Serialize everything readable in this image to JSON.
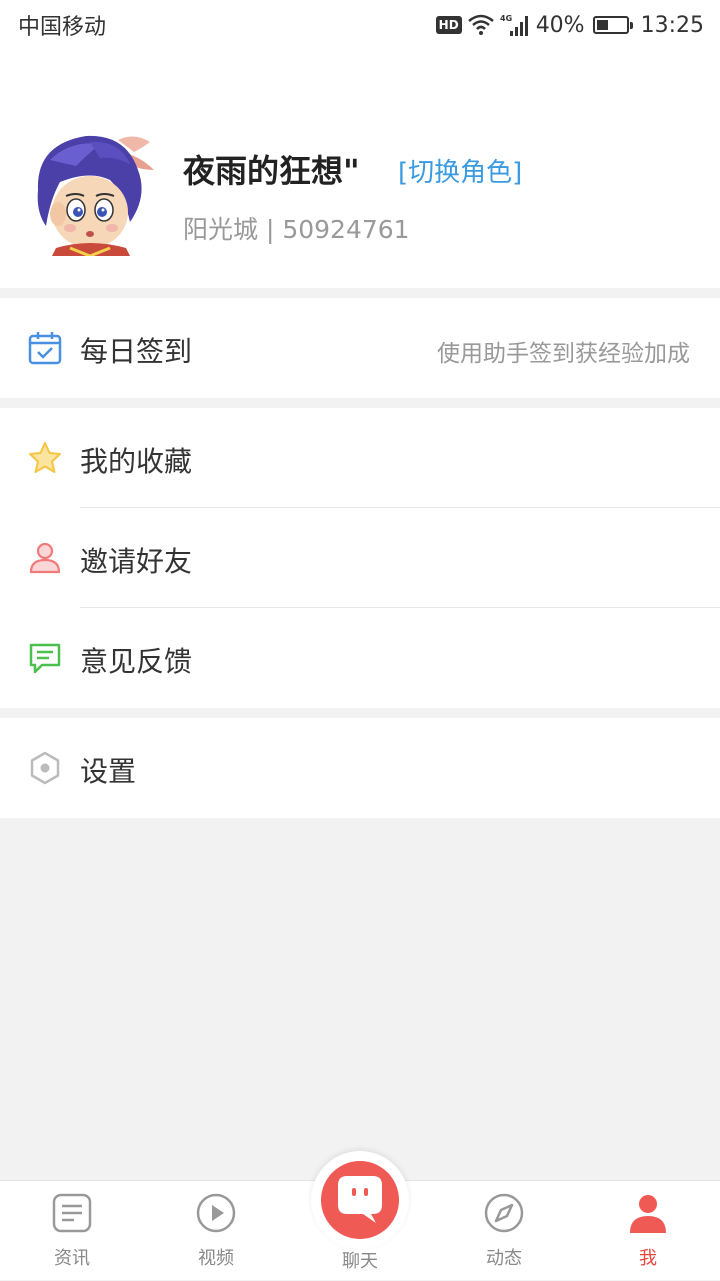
{
  "status_bar": {
    "carrier": "中国移动",
    "hd": "HD",
    "network": "4G",
    "battery": "40%",
    "battery_level": 0.4,
    "time": "13:25"
  },
  "profile": {
    "name": "夜雨的狂想\"",
    "switch_role": "[切换角色]",
    "server_and_id": "阳光城 | 50924761"
  },
  "menu": {
    "checkin": {
      "label": "每日签到",
      "hint": "使用助手签到获经验加成",
      "icon": "calendar-check-icon",
      "color": "#4a90e2"
    },
    "favorites": {
      "label": "我的收藏",
      "icon": "star-icon",
      "color": "#f5c542"
    },
    "invite": {
      "label": "邀请好友",
      "icon": "person-icon",
      "color": "#f07a7a"
    },
    "feedback": {
      "label": "意见反馈",
      "icon": "message-icon",
      "color": "#4cc04c"
    },
    "settings": {
      "label": "设置",
      "icon": "hexagon-icon",
      "color": "#bbbbbb"
    }
  },
  "tabbar": {
    "active_color": "#e8473e",
    "tabs": [
      {
        "label": "资讯",
        "icon": "news-icon"
      },
      {
        "label": "视频",
        "icon": "play-icon"
      },
      {
        "label": "聊天",
        "icon": "chat-icon"
      },
      {
        "label": "动态",
        "icon": "compass-icon"
      },
      {
        "label": "我",
        "icon": "user-icon"
      }
    ]
  }
}
